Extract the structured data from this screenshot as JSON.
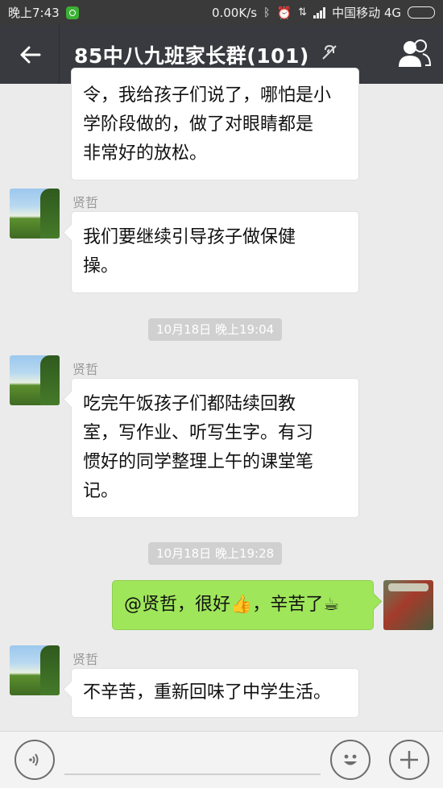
{
  "status_bar": {
    "time": "晚上7:43",
    "network_speed": "0.00K/s",
    "carrier": "中国移动 4G"
  },
  "header": {
    "title": "85中八九班家长群(101)"
  },
  "messages": [
    {
      "type": "text",
      "side": "left",
      "text_lines": [
        "令，我给孩子们说了，哪怕是小",
        "学阶段做的，做了对眼睛都是",
        "非常好的放松。"
      ]
    },
    {
      "type": "text",
      "side": "left",
      "sender": "贤哲",
      "text_lines": [
        "我们要继续引导孩子做保健",
        "操。"
      ]
    },
    {
      "type": "timestamp",
      "text": "10月18日 晚上19:04"
    },
    {
      "type": "text",
      "side": "left",
      "sender": "贤哲",
      "text_lines": [
        "吃完午饭孩子们都陆续回教",
        "室，写作业、听写生字。有习",
        "惯好的同学整理上午的课堂笔",
        "记。"
      ]
    },
    {
      "type": "timestamp",
      "text": "10月18日 晚上19:28"
    },
    {
      "type": "text",
      "side": "right",
      "text": "@贤哲，很好👍，辛苦了☕"
    },
    {
      "type": "text",
      "side": "left",
      "sender": "贤哲",
      "text": "不辛苦，重新回味了中学生活。"
    }
  ],
  "colors": {
    "title_bar": "#393a3f",
    "status_bar": "#3a3a3a",
    "chat_bg": "#ebebeb",
    "my_bubble": "#9fe65a",
    "other_bubble": "#ffffff"
  },
  "icons": [
    "back-arrow-icon",
    "mute-icon",
    "members-icon",
    "voice-icon",
    "emoji-icon",
    "plus-icon"
  ]
}
